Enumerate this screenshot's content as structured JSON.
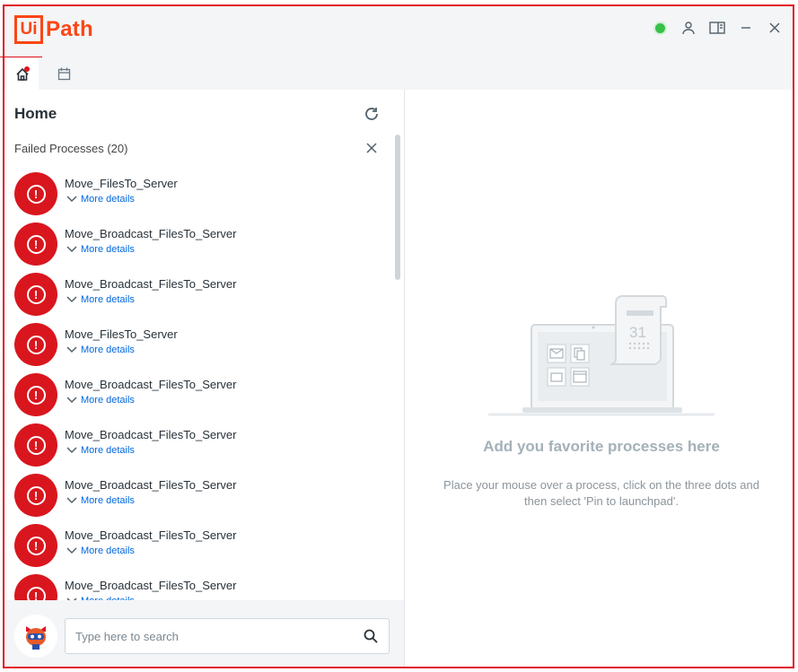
{
  "app": {
    "logo_box": "Ui",
    "logo_text": "Path",
    "brand_color": "#fa4616"
  },
  "window": {
    "status_color": "#38c148"
  },
  "home": {
    "title": "Home",
    "failed_header": "Failed Processes (20)",
    "more_label": "More details",
    "items": [
      {
        "name": "Move_FilesTo_Server"
      },
      {
        "name": "Move_Broadcast_FilesTo_Server"
      },
      {
        "name": "Move_Broadcast_FilesTo_Server"
      },
      {
        "name": "Move_FilesTo_Server"
      },
      {
        "name": "Move_Broadcast_FilesTo_Server"
      },
      {
        "name": "Move_Broadcast_FilesTo_Server"
      },
      {
        "name": "Move_Broadcast_FilesTo_Server"
      },
      {
        "name": "Move_Broadcast_FilesTo_Server"
      },
      {
        "name": "Move_Broadcast_FilesTo_Server"
      }
    ]
  },
  "search": {
    "placeholder": "Type here to search"
  },
  "launchpad": {
    "calendar_day": "31",
    "empty_title": "Add you favorite processes here",
    "empty_desc": "Place your mouse over a process, click on the three dots and then select 'Pin to launchpad'."
  }
}
